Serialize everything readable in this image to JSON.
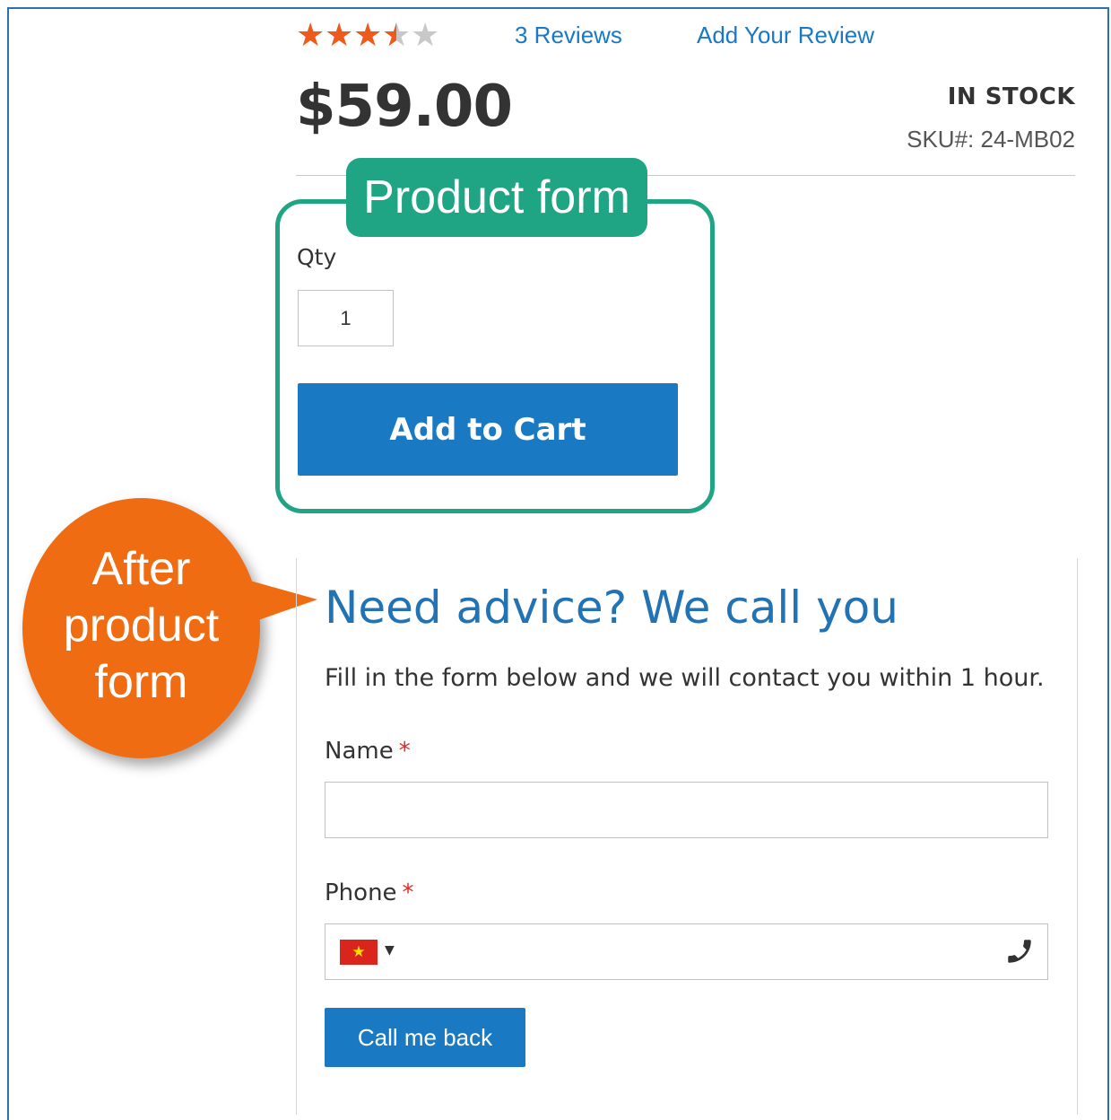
{
  "rating": {
    "value": 3.5,
    "max": 5,
    "color": "#ee5a1c"
  },
  "reviews": {
    "count_label": "3  Reviews",
    "add_label": "Add Your Review"
  },
  "price": "$59.00",
  "stock_status": "IN STOCK",
  "sku": "SKU#:  24-MB02",
  "product_form": {
    "annotation": "Product form",
    "qty_label": "Qty",
    "qty_value": "1",
    "add_to_cart_label": "Add to Cart",
    "annotation_color": "#1fa484"
  },
  "callout": {
    "line1": "After",
    "line2": "product",
    "line3": "form",
    "color": "#ef6c13"
  },
  "callback_widget": {
    "title": "Need advice? We call you",
    "description": "Fill in the form below and we will contact you within 1 hour.",
    "name_label": "Name",
    "phone_label": "Phone",
    "required_marker": "*",
    "flag_icon": "vietnam-flag-icon",
    "submit_label": "Call me back"
  },
  "colors": {
    "accent": "#1979c3",
    "title": "#2273b4",
    "required": "#e02b27"
  }
}
